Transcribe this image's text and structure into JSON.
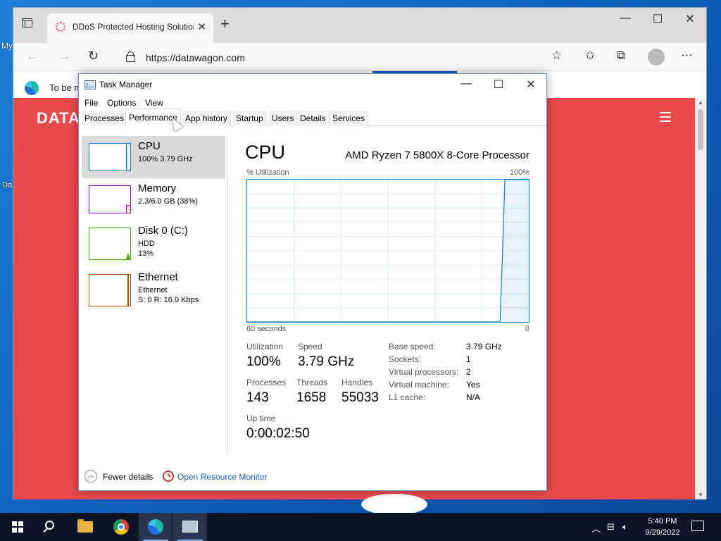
{
  "desktop": {
    "frag1": "My",
    "frag2": "Da"
  },
  "browser": {
    "tab_title": "DDoS Protected Hosting Solutions",
    "tab_close": "✕",
    "new_tab": "+",
    "url": "https://datawagon.com",
    "infobar_text": "To be m",
    "site_logo": "DATA",
    "window_controls": {
      "minimize": "—",
      "maximize": "☐",
      "close": "✕"
    }
  },
  "task_manager": {
    "title": "Task Manager",
    "controls": {
      "minimize": "—",
      "maximize": "☐",
      "close": "✕"
    },
    "menu": [
      "File",
      "Options",
      "View"
    ],
    "tabs": [
      "Processes",
      "Performance",
      "App history",
      "Startup",
      "Users",
      "Details",
      "Services"
    ],
    "active_tab": "Performance",
    "resources": [
      {
        "name": "CPU",
        "line1": "100% 3.79 GHz",
        "color": "#117dbb"
      },
      {
        "name": "Memory",
        "line1": "2.3/6.0 GB (38%)",
        "color": "#8b12ae"
      },
      {
        "name": "Disk 0 (C:)",
        "line1": "HDD",
        "line2": "13%",
        "color": "#4da60c"
      },
      {
        "name": "Ethernet",
        "line1": "Ethernet",
        "line2": "S: 0 R: 16.0 Kbps",
        "color": "#a74f01"
      }
    ],
    "main": {
      "title": "CPU",
      "processor": "AMD Ryzen 7 5800X 8-Core Processor",
      "util_label": "% Utilization",
      "max_label": "100%",
      "time_label": "60 seconds",
      "min_label": "0",
      "stats": {
        "utilization_label": "Utilization",
        "utilization": "100%",
        "speed_label": "Speed",
        "speed": "3.79 GHz",
        "processes_label": "Processes",
        "processes": "143",
        "threads_label": "Threads",
        "threads": "1658",
        "handles_label": "Handles",
        "handles": "55033",
        "uptime_label": "Up time",
        "uptime": "0:00:02:50"
      },
      "details": [
        {
          "k": "Base speed:",
          "v": "3.79 GHz"
        },
        {
          "k": "Sockets:",
          "v": "1"
        },
        {
          "k": "Virtual processors:",
          "v": "2"
        },
        {
          "k": "Virtual machine:",
          "v": "Yes"
        },
        {
          "k": "L1 cache:",
          "v": "N/A"
        }
      ],
      "graph_series": [
        0,
        0,
        0,
        0,
        0,
        0,
        0,
        0,
        0,
        0,
        0,
        0,
        0,
        0,
        0,
        0,
        0,
        0,
        0,
        0,
        0,
        0,
        0,
        0,
        0,
        0,
        0,
        0,
        0,
        0,
        0,
        0,
        0,
        0,
        0,
        0,
        0,
        0,
        0,
        0,
        0,
        0,
        0,
        0,
        0,
        0,
        0,
        0,
        0,
        0,
        0,
        0,
        0,
        0,
        100,
        100,
        100,
        100,
        100,
        100
      ]
    },
    "footer": {
      "fewer": "Fewer details",
      "resource_monitor": "Open Resource Monitor"
    }
  },
  "taskbar": {
    "time": "5:40 PM",
    "date": "9/29/2022"
  }
}
